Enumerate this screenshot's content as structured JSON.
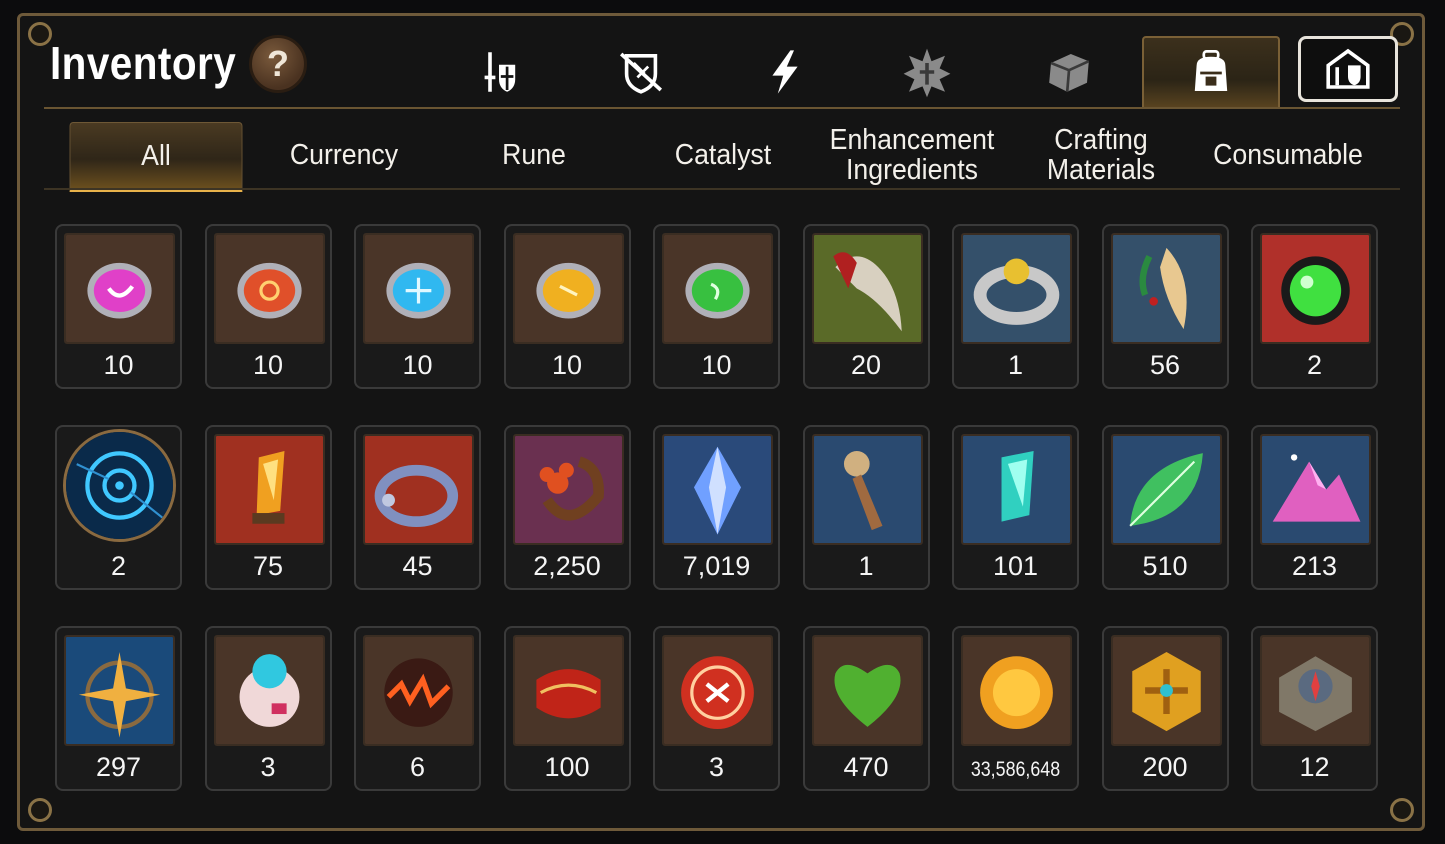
{
  "header": {
    "title": "Inventory",
    "help_label": "?"
  },
  "category_tabs": [
    {
      "name": "tab-equipment",
      "icon": "sword-shield-icon",
      "active": false
    },
    {
      "name": "tab-artifacts",
      "icon": "broken-shield-icon",
      "active": false
    },
    {
      "name": "tab-skills",
      "icon": "lightning-icon",
      "active": false
    },
    {
      "name": "tab-exclusive",
      "icon": "star-emblem-icon",
      "active": false
    },
    {
      "name": "tab-cube",
      "icon": "cube-icon",
      "active": false
    },
    {
      "name": "tab-bag",
      "icon": "backpack-icon",
      "active": true
    },
    {
      "name": "tab-storage",
      "icon": "storage-house-icon",
      "active": false
    }
  ],
  "sub_tabs": [
    "All",
    "Currency",
    "Rune",
    "Catalyst",
    "Enhancement\nIngredients",
    "Crafting\nMaterials",
    "Consumable"
  ],
  "active_sub_tab": "All",
  "colors": {
    "accent": "#e8b24a",
    "frame": "#6e5a3a"
  },
  "items": [
    {
      "icon": "purple-rune-icon",
      "count": "10"
    },
    {
      "icon": "red-rune-icon",
      "count": "10"
    },
    {
      "icon": "blue-rune-icon",
      "count": "10"
    },
    {
      "icon": "yellow-rune-icon",
      "count": "10"
    },
    {
      "icon": "green-rune-icon",
      "count": "10"
    },
    {
      "icon": "claw-icon",
      "count": "20"
    },
    {
      "icon": "ring-icon",
      "count": "1"
    },
    {
      "icon": "feather-charm-icon",
      "count": "56"
    },
    {
      "icon": "green-orb-icon",
      "count": "2"
    },
    {
      "icon": "rune-disc-icon",
      "count": "2"
    },
    {
      "icon": "amber-crystal-icon",
      "count": "75"
    },
    {
      "icon": "bracelet-icon",
      "count": "45"
    },
    {
      "icon": "flower-ring-icon",
      "count": "2,250"
    },
    {
      "icon": "blue-gem-icon",
      "count": "7,019"
    },
    {
      "icon": "pendulum-icon",
      "count": "1"
    },
    {
      "icon": "teal-crystal-icon",
      "count": "101"
    },
    {
      "icon": "leaf-icon",
      "count": "510"
    },
    {
      "icon": "pink-mountain-icon",
      "count": "213"
    },
    {
      "icon": "compass-star-icon",
      "count": "297"
    },
    {
      "icon": "robot-orb-icon",
      "count": "3"
    },
    {
      "icon": "lava-orb-icon",
      "count": "6"
    },
    {
      "icon": "red-cuff-icon",
      "count": "100"
    },
    {
      "icon": "red-seal-icon",
      "count": "3"
    },
    {
      "icon": "green-heart-icon",
      "count": "470"
    },
    {
      "icon": "gold-coin-icon",
      "count": "33,586,648"
    },
    {
      "icon": "gold-hexagon-icon",
      "count": "200"
    },
    {
      "icon": "stone-compass-icon",
      "count": "12"
    }
  ]
}
